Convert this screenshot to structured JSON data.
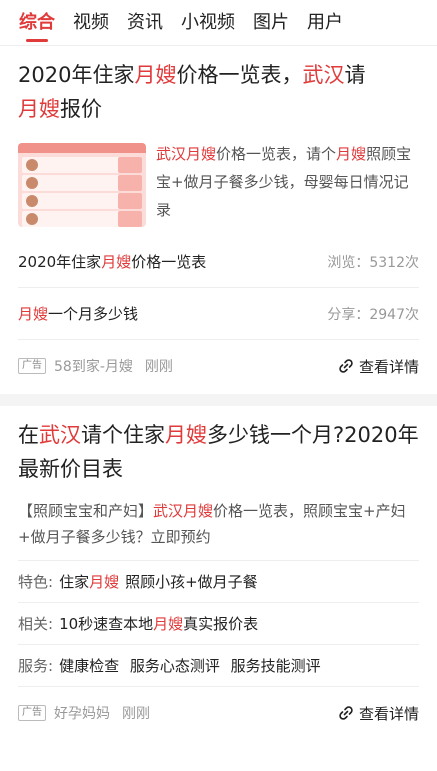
{
  "tabs": [
    "综合",
    "视频",
    "资讯",
    "小视频",
    "图片",
    "用户"
  ],
  "card1": {
    "title_a": "2020年住家",
    "title_b": "月嫂",
    "title_c": "价格一览表，",
    "title_d": "武汉",
    "title_e": "请",
    "title_f": "月嫂",
    "title_g": "报价",
    "desc": [
      "武汉",
      "月嫂",
      "价格一览表，请个",
      "月嫂",
      "照顾宝宝+做月子餐多少钱，母婴每日情况记录"
    ],
    "stat1": {
      "a": "2020年住家",
      "b": "月嫂",
      "c": "价格一览表",
      "right": "浏览：5312次"
    },
    "stat2": {
      "a": "",
      "b": "月嫂",
      "c": "一个月多少钱",
      "right": "分享：2947次"
    },
    "ad": {
      "tag": "广告",
      "source": "58到家-月嫂",
      "time": "刚刚",
      "detail": "查看详情"
    }
  },
  "card2": {
    "title": [
      "在",
      "武汉",
      "请个住家",
      "月嫂",
      "多少钱一个月?2020年最新价目表"
    ],
    "desc": [
      "【照顾宝宝和产妇】",
      "武汉",
      "月嫂",
      "价格一览表，照顾宝宝+产妇+做月子餐多少钱？立即预约"
    ],
    "f1": {
      "k": "特色:",
      "a": "住家",
      "b": "月嫂",
      "c": "照顾小孩+做月子餐"
    },
    "f2": {
      "k": "相关:",
      "a": "10秒速查本地",
      "b": "月嫂",
      "c": "真实报价表"
    },
    "f3": {
      "k": "服务:",
      "v": [
        "健康检查",
        "服务心态测评",
        "服务技能测评"
      ]
    },
    "ad": {
      "tag": "广告",
      "source": "好孕妈妈",
      "time": "刚刚",
      "detail": "查看详情"
    }
  },
  "colors": {
    "accent": "#e03a3a"
  }
}
